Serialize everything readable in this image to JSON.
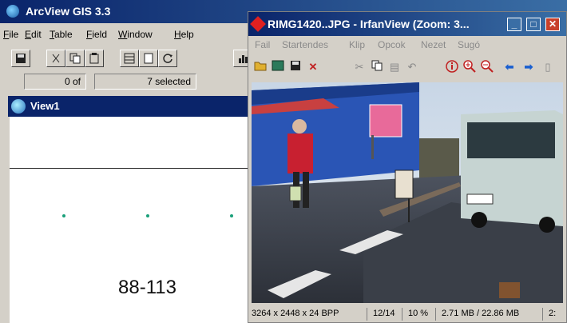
{
  "arcview": {
    "title": "ArcView GIS 3.3",
    "menu": [
      "File",
      "Edit",
      "Table",
      "Field",
      "Window",
      "Help"
    ],
    "selection": {
      "count": "0 of",
      "selected": "7 selected"
    },
    "view": {
      "title": "View1",
      "label": "88-113"
    }
  },
  "irfanview": {
    "title": "RIMG1420..JPG - IrfanView (Zoom: 3...",
    "menu": [
      "Fail",
      "Startendes",
      "Klip",
      "Opcok",
      "Nezet",
      "Sugó"
    ],
    "window_buttons": {
      "minimize": "_",
      "maximize": "□",
      "close": "✕"
    },
    "status": {
      "dimensions": "3264 x 2448 x 24 BPP",
      "index": "12/14",
      "zoom": "10 %",
      "size": "2.71 MB / 22.86 MB",
      "extra": "2:"
    }
  },
  "colors": {
    "title_active": "#0a246a",
    "accent": "#3a6ea5",
    "dot": "#1aa07a"
  }
}
